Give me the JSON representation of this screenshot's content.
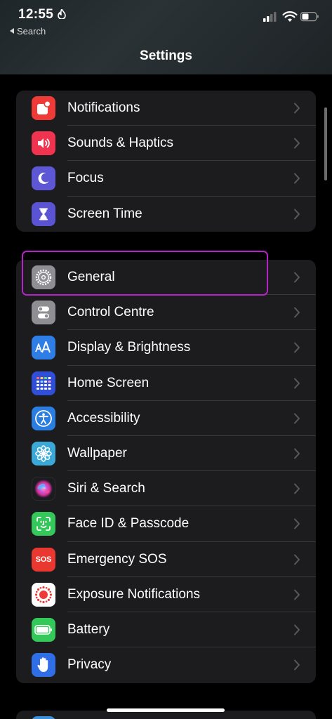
{
  "status": {
    "time": "12:55",
    "back_label": "Search"
  },
  "nav": {
    "title": "Settings"
  },
  "groups": [
    {
      "items": [
        {
          "label": "Notifications",
          "icon": "notifications-icon",
          "color": "#ef3b37"
        },
        {
          "label": "Sounds & Haptics",
          "icon": "sounds-icon",
          "color": "#f0334f"
        },
        {
          "label": "Focus",
          "icon": "moon-icon",
          "color": "#5d56d5"
        },
        {
          "label": "Screen Time",
          "icon": "hourglass-icon",
          "color": "#5b54d2"
        }
      ]
    },
    {
      "items": [
        {
          "label": "General",
          "icon": "gear-icon",
          "color": "#8e8e93"
        },
        {
          "label": "Control Centre",
          "icon": "toggles-icon",
          "color": "#8e8e93"
        },
        {
          "label": "Display & Brightness",
          "icon": "text-size-icon",
          "color": "#2f7ee6"
        },
        {
          "label": "Home Screen",
          "icon": "app-grid-icon",
          "color": "#2f4fd8"
        },
        {
          "label": "Accessibility",
          "icon": "accessibility-icon",
          "color": "#2a7ee2"
        },
        {
          "label": "Wallpaper",
          "icon": "flower-icon",
          "color": "#3aa9d8"
        },
        {
          "label": "Siri & Search",
          "icon": "siri-icon",
          "color": "#1c1c1e"
        },
        {
          "label": "Face ID & Passcode",
          "icon": "face-id-icon",
          "color": "#34c759"
        },
        {
          "label": "Emergency SOS",
          "icon": "sos-icon",
          "color": "#e9382f",
          "text": "SOS"
        },
        {
          "label": "Exposure Notifications",
          "icon": "exposure-icon",
          "color": "#ffffff"
        },
        {
          "label": "Battery",
          "icon": "battery-icon",
          "color": "#34c759"
        },
        {
          "label": "Privacy",
          "icon": "hand-icon",
          "color": "#2f6ee6"
        }
      ]
    }
  ],
  "highlight": {
    "color": "#b523c9",
    "target": "General"
  }
}
